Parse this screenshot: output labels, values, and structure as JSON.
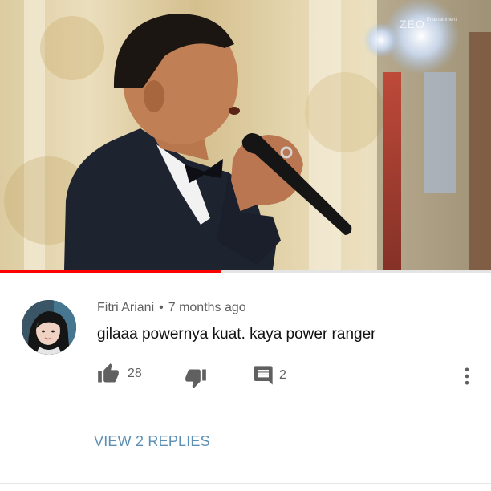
{
  "video": {
    "watermark_text": "ZEO",
    "watermark_small": "Entertainment",
    "progress_percent": 45,
    "progress_color": "#ff0000"
  },
  "comment": {
    "author": "Fitri Ariani",
    "separator": "•",
    "time": "7 months ago",
    "text": "gilaaa powernya kuat. kaya power ranger",
    "like_count": "28",
    "reply_count": "2",
    "view_replies_label": "VIEW 2 REPLIES",
    "link_color": "#5b8fb3"
  },
  "icons": {
    "like": "thumbs-up-icon",
    "dislike": "thumbs-down-icon",
    "reply": "comment-icon",
    "more": "more-vertical-icon"
  }
}
